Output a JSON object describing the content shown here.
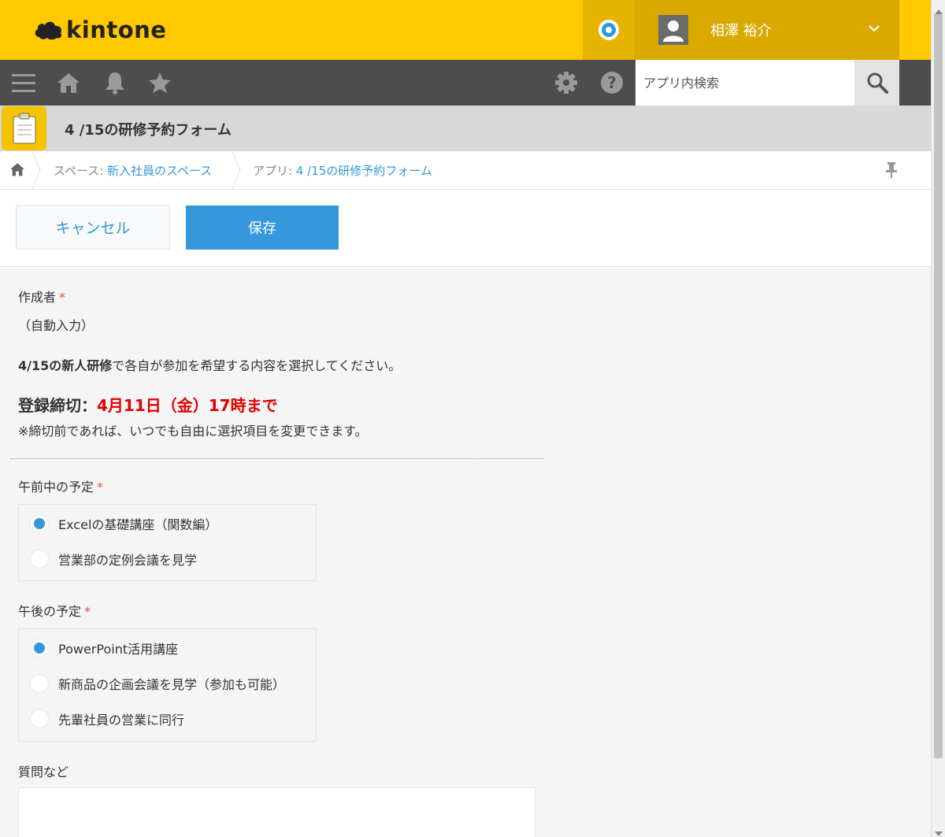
{
  "header": {
    "logo_text": "kintone",
    "user_name": "相澤 裕介"
  },
  "navbar": {
    "icons": [
      "menu-icon",
      "home-icon",
      "bell-icon",
      "star-icon",
      "gear-icon",
      "help-icon",
      "search-icon"
    ],
    "search_placeholder": "アプリ内検索"
  },
  "app": {
    "title": "4 /15の研修予約フォーム"
  },
  "breadcrumb": {
    "space_prefix": "スペース:",
    "space_name": "新入社員のスペース",
    "app_prefix": "アプリ:",
    "app_name": "4 /15の研修予約フォーム"
  },
  "actions": {
    "cancel_label": "キャンセル",
    "save_label": "保存"
  },
  "form": {
    "creator_label": "作成者",
    "required_mark": "*",
    "creator_value": "（自動入力）",
    "intro_bold": "4/15の新人研修",
    "intro_rest": "で各自が参加を希望する内容を選択してください。",
    "deadline_label": "登録締切：",
    "deadline_value": "4月11日（金）17時まで",
    "note": "※締切前であれば、いつでも自由に選択項目を変更できます。",
    "morning_label": "午前中の予定",
    "morning_options": [
      {
        "label": "Excelの基礎講座（関数編）",
        "selected": true
      },
      {
        "label": "営業部の定例会議を見学",
        "selected": false
      }
    ],
    "afternoon_label": "午後の予定",
    "afternoon_options": [
      {
        "label": "PowerPoint活用講座",
        "selected": true
      },
      {
        "label": "新商品の企画会議を見学（参加も可能）",
        "selected": false
      },
      {
        "label": "先輩社員の営業に同行",
        "selected": false
      }
    ],
    "questions_label": "質問など",
    "questions_value": ""
  },
  "colors": {
    "header": "#ffc800",
    "navbar": "#4d4d4d",
    "accent": "#3498db",
    "required": "#e74c3c",
    "deadline": "#e00000"
  }
}
